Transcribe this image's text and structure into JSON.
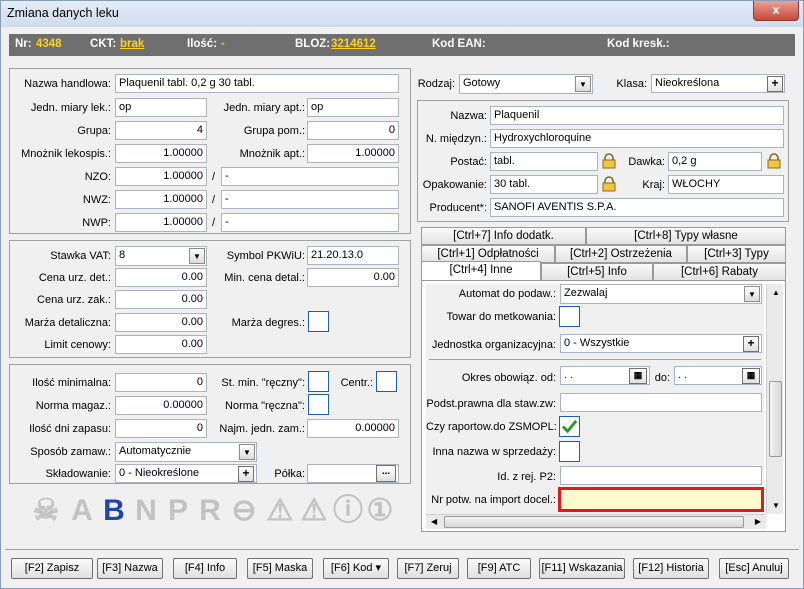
{
  "window": {
    "title": "Zmiana danych leku",
    "close_label": "x"
  },
  "infobar": {
    "nr_label": "Nr:",
    "nr_value": "4348",
    "ckt_label": "CKT:",
    "ckt_value": "brak",
    "ilosc_label": "Ilość:",
    "ilosc_value": "-",
    "bloz_label": "BLOZ:",
    "bloz_value": "3214612",
    "ean_label": "Kod EAN:",
    "kresk_label": "Kod kresk.:"
  },
  "main": {
    "nazwa_handlowa_label": "Nazwa handlowa:",
    "nazwa_handlowa": "Plaquenil tabl. 0,2 g 30 tabl.",
    "jm_lek_label": "Jedn. miary lek.:",
    "jm_lek": "op",
    "jm_apt_label": "Jedn. miary apt.:",
    "jm_apt": "op",
    "grupa_label": "Grupa:",
    "grupa": "4",
    "grupa_pom_label": "Grupa pom.:",
    "grupa_pom": "0",
    "mnoznik_lek_label": "Mnożnik lekospis.:",
    "mnoznik_lek": "1.00000",
    "mnoznik_apt_label": "Mnożnik apt.:",
    "mnoznik_apt": "1.00000",
    "nzo_label": "NZO:",
    "nzo": "1.00000",
    "nzo_extra": "-",
    "nwz_label": "NWZ:",
    "nwz": "1.00000",
    "nwz_extra": "-",
    "nwp_label": "NWP:",
    "nwp": "1.00000",
    "nwp_extra": "-",
    "slash": "/"
  },
  "vat": {
    "stawka_label": "Stawka VAT:",
    "stawka": "8",
    "pkwiu_label": "Symbol PKWiU:",
    "pkwiu": "21.20.13.0",
    "cena_urz_det_label": "Cena urz. det.:",
    "cena_urz_det": "0.00",
    "min_cena_label": "Min. cena detal.:",
    "min_cena": "0.00",
    "cena_urz_zak_label": "Cena urz. zak.:",
    "cena_urz_zak": "0.00",
    "marza_det_label": "Marża detaliczna:",
    "marza_det": "0.00",
    "marza_degres_label": "Marża degres.:",
    "limit_label": "Limit cenowy:",
    "limit": "0.00"
  },
  "stock": {
    "ilosc_min_label": "Ilość minimalna:",
    "ilosc_min": "0",
    "st_min_label": "St. min. \"ręczny\":",
    "centr_label": "Centr.:",
    "norma_label": "Norma magaz.:",
    "norma": "0.00000",
    "norma_reczna_label": "Norma \"ręczna\":",
    "dni_label": "Ilość dni zapasu:",
    "dni": "0",
    "najm_label": "Najm. jedn. zam.:",
    "najm": "0.00000",
    "sposob_label": "Sposób zamaw.:",
    "sposob": "Automatycznie",
    "skladowanie_label": "Składowanie:",
    "skladowanie": "0 - Nieokreślone",
    "polka_label": "Półka:",
    "polka_btn": "..."
  },
  "badges": [
    "☠",
    "A",
    "B",
    "N",
    "P",
    "R",
    "⊖",
    "⚠",
    "⚠",
    "ⓘ",
    "①"
  ],
  "right": {
    "rodzaj_label": "Rodzaj:",
    "rodzaj": "Gotowy",
    "klasa_label": "Klasa:",
    "klasa": "Nieokreślona",
    "nazwa_label": "Nazwa:",
    "nazwa": "Plaquenil",
    "miedzyn_label": "N. międzyn.:",
    "miedzyn": "Hydroxychloroquine",
    "postac_label": "Postać:",
    "postac": "tabl.",
    "dawka_label": "Dawka:",
    "dawka": "0,2 g",
    "opakowanie_label": "Opakowanie:",
    "opakowanie": "30 tabl.",
    "kraj_label": "Kraj:",
    "kraj": "WŁOCHY",
    "producent_label": "Producent*:",
    "producent": "SANOFI AVENTIS S.P.A."
  },
  "tabs": {
    "row1": [
      "[Ctrl+7] Info dodatk.",
      "[Ctrl+8] Typy własne"
    ],
    "row2": [
      "[Ctrl+1] Odpłatności",
      "[Ctrl+2] Ostrzeżenia",
      "[Ctrl+3] Typy"
    ],
    "row3": [
      "[Ctrl+4] Inne",
      "[Ctrl+5] Info",
      "[Ctrl+6] Rabaty"
    ]
  },
  "inne": {
    "automat_label": "Automat do podaw.:",
    "automat": "Zezwalaj",
    "towar_label": "Towar do metkowania:",
    "jednostka_label": "Jednostka organizacyjna:",
    "jednostka": "0 - Wszystkie",
    "okres_label": "Okres obowiąz. od:",
    "okres_od": " .  .",
    "do_label": "do:",
    "okres_do": " .  .",
    "podst_label": "Podst.prawna dla staw.zw:",
    "zsmopl_label": "Czy raportow.do ZSMOPL:",
    "inna_nazwa_label": "Inna nazwa w sprzedaży:",
    "id_rej_label": "Id. z rej. P2:",
    "nr_potw_label": "Nr potw. na import docel.:"
  },
  "fkeys": [
    "[F2] Zapisz",
    "[F3] Nazwa",
    "[F4] Info",
    "[F5] Maska",
    "[F6] Kod ▾",
    "[F7] Zeruj",
    "[F9] ATC",
    "[F11] Wskazania",
    "[F12] Historia",
    "[Esc] Anuluj"
  ]
}
